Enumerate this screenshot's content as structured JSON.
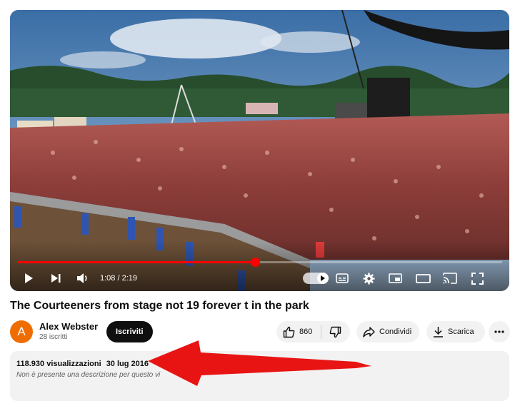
{
  "player": {
    "time_display": "1:08 / 2:19",
    "progress_fraction": 0.49
  },
  "video": {
    "title": "The Courteeners from stage not 19 forever t in the park"
  },
  "channel": {
    "avatar_letter": "A",
    "name": "Alex Webster",
    "subscribers": "28 iscritti",
    "subscribe_label": "Iscriviti"
  },
  "actions": {
    "like_count": "860",
    "share_label": "Condividi",
    "download_label": "Scarica"
  },
  "description": {
    "views": "118.930 visualizzazioni",
    "date": "30 lug 2016",
    "text": "Non è presente una descrizione per questo vi"
  },
  "colors": {
    "progress": "#ff0000",
    "annotation_arrow": "#e81414",
    "avatar": "#ef6c00"
  },
  "icons": [
    "play-icon",
    "next-icon",
    "volume-icon",
    "autoplay-toggle-icon",
    "subtitles-icon",
    "settings-icon",
    "miniplayer-icon",
    "theater-icon",
    "cast-icon",
    "fullscreen-icon",
    "thumb-up-icon",
    "thumb-down-icon",
    "share-icon",
    "download-icon",
    "more-icon"
  ]
}
